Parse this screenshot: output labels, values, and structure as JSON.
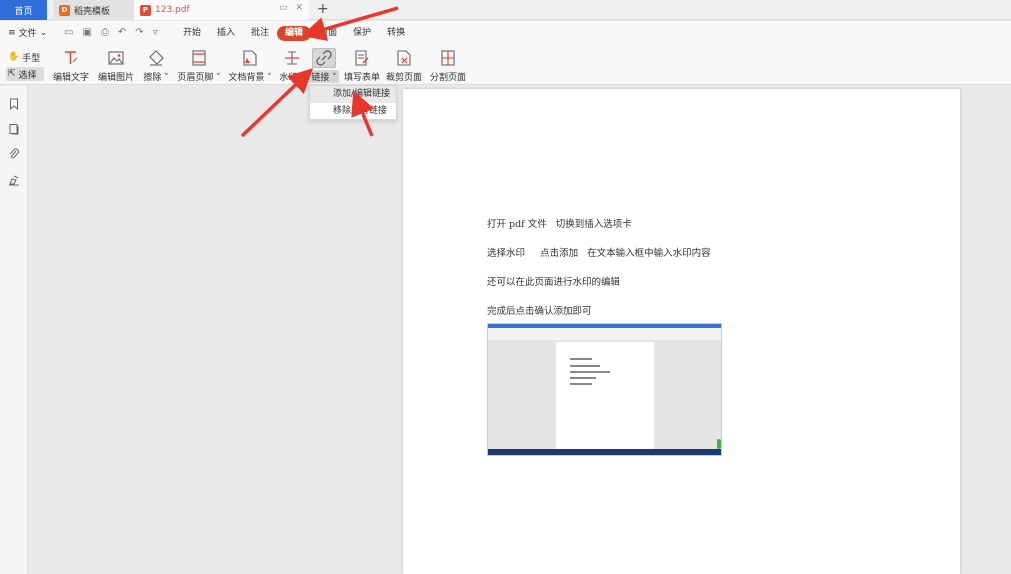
{
  "tabs": {
    "home": "首页",
    "template": "稻壳模板",
    "pdf": "123.pdf",
    "pdf_icon": "P",
    "template_icon": "D"
  },
  "menubar": {
    "file": "文件",
    "tabs": [
      "开始",
      "插入",
      "批注",
      "编辑",
      "页面",
      "保护",
      "转换"
    ],
    "active_tab": "编辑"
  },
  "ribbon": {
    "hand": "手型",
    "select": "选择",
    "tools": [
      {
        "label": "编辑文字",
        "icon": "edit-text-icon"
      },
      {
        "label": "编辑图片",
        "icon": "edit-image-icon"
      },
      {
        "label": "擦除 ˅",
        "icon": "eraser-icon"
      },
      {
        "label": "页眉页脚 ˅",
        "icon": "header-footer-icon"
      },
      {
        "label": "文档背景 ˅",
        "icon": "background-icon"
      },
      {
        "label": "水印 ˅",
        "icon": "watermark-icon"
      },
      {
        "label": "链接 ˅",
        "icon": "link-icon"
      },
      {
        "label": "填写表单",
        "icon": "form-icon"
      },
      {
        "label": "裁剪页面",
        "icon": "crop-icon"
      },
      {
        "label": "分割页面",
        "icon": "split-icon"
      }
    ]
  },
  "dropdown": {
    "items": [
      "添加/编辑链接",
      "移除所有链接"
    ]
  },
  "document": {
    "lines": [
      "打开 pdf 文件   切换到插入选项卡",
      "选择水印     点击添加   在文本输入框中输入水印内容",
      "还可以在此页面进行水印的编辑",
      "完成后点击确认添加即可"
    ]
  },
  "colors": {
    "accent_blue": "#2f6fdb",
    "active_red": "#d9472b",
    "arrow_red": "#e8382c"
  }
}
